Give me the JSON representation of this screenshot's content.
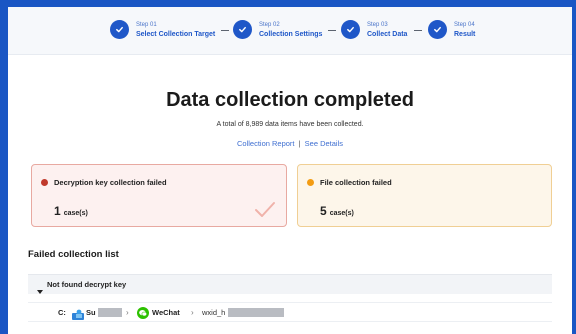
{
  "stepper": {
    "steps": [
      {
        "number": "Step 01",
        "label": "Select Collection Target"
      },
      {
        "number": "Step 02",
        "label": "Collection Settings"
      },
      {
        "number": "Step 03",
        "label": "Collect Data"
      },
      {
        "number": "Step 04",
        "label": "Result"
      }
    ]
  },
  "summary": {
    "title": "Data collection completed",
    "subtitle": "A total of 8,989 data items have been collected.",
    "report_link": "Collection Report",
    "separator": "|",
    "details_link": "See Details"
  },
  "cards": {
    "key_failed": {
      "label": "Decryption key collection failed",
      "count": "1",
      "unit": "case(s)"
    },
    "file_failed": {
      "label": "File collection failed",
      "count": "5",
      "unit": "case(s)"
    }
  },
  "failed_list": {
    "title": "Failed collection list",
    "group_label": "Not found decrypt key",
    "path": {
      "drive": "C:",
      "user": "Su",
      "app": "WeChat",
      "wxid": "wxid_h"
    }
  },
  "colors": {
    "accent": "#1f57c8",
    "error": "#c0392b",
    "warning": "#f39c12"
  }
}
